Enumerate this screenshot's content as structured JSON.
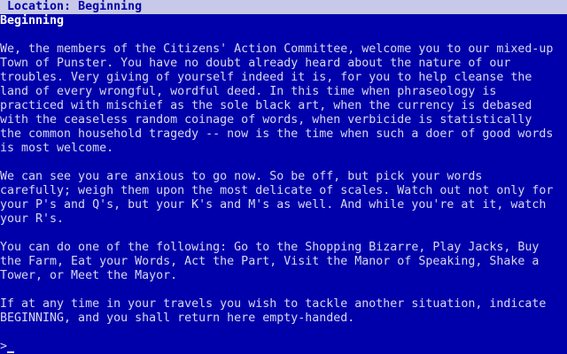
{
  "status_bar": {
    "location_label": "Location:",
    "location_value": "Beginning"
  },
  "room": {
    "title": "Beginning",
    "paragraphs": [
      [
        "We, the members of the Citizens' Action Committee, welcome you to our mixed-up",
        "Town of Punster. You have no doubt already heard about the nature of our",
        "troubles. Very giving of yourself indeed it is, for you to help cleanse the",
        "land of every wrongful, wordful deed. In this time when phraseology is",
        "practiced with mischief as the sole black art, when the currency is debased",
        "with the ceaseless random coinage of words, when verbicide is statistically",
        "the common household tragedy -- now is the time when such a doer of good words",
        "is most welcome."
      ],
      [
        "We can see you are anxious to go now. So be off, but pick your words",
        "carefully; weigh them upon the most delicate of scales. Watch out not only for",
        "your P's and Q's, but your K's and M's as well. And while you're at it, watch",
        "your R's."
      ],
      [
        "You can do one of the following: Go to the Shopping Bizarre, Play Jacks, Buy",
        "the Farm, Eat your Words, Act the Part, Visit the Manor of Speaking, Shake a",
        "Tower, or Meet the Mayor."
      ],
      [
        "If at any time in your travels you wish to tackle another situation, indicate",
        "BEGINNING, and you shall return here empty-handed."
      ]
    ]
  },
  "prompt": {
    "symbol": ">",
    "input_value": ""
  },
  "colors": {
    "background": "#0000AA",
    "text": "#D8D8F0",
    "status_bar_bg": "#C8C8E8",
    "status_bar_text": "#0000AA"
  }
}
